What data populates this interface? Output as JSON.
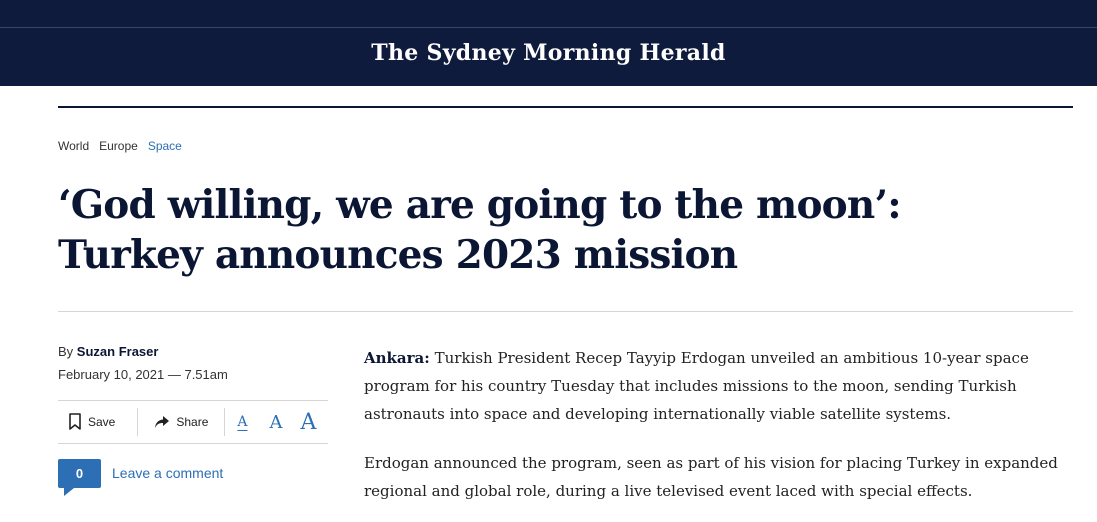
{
  "header": {
    "masthead": "The Sydney Morning Herald"
  },
  "breadcrumb": [
    "World",
    "Europe",
    "Space"
  ],
  "article": {
    "headline": "‘God willing, we are going to the moon’: Turkey announces 2023 mission",
    "byline_prefix": "By",
    "author": "Suzan Fraser",
    "date": "February 10, 2021 — 7.51am",
    "location": "Ankara:",
    "para1": "Turkish President Recep Tayyip Erdogan unveiled an ambitious 10-year space program for his country Tuesday that includes missions to the moon, sending Turkish astronauts into space and developing internationally viable satellite systems.",
    "para2": "Erdogan announced the program, seen as part of his vision for placing Turkey in expanded regional and global role, during a live televised event laced with special effects."
  },
  "toolbar": {
    "save_label": "Save",
    "share_label": "Share",
    "font_small": "A",
    "font_medium": "A",
    "font_large": "A"
  },
  "comments": {
    "count": "0",
    "link_label": "Leave a comment"
  },
  "colors": {
    "navy": "#0f1b3d",
    "link_blue": "#2c6fb4"
  }
}
